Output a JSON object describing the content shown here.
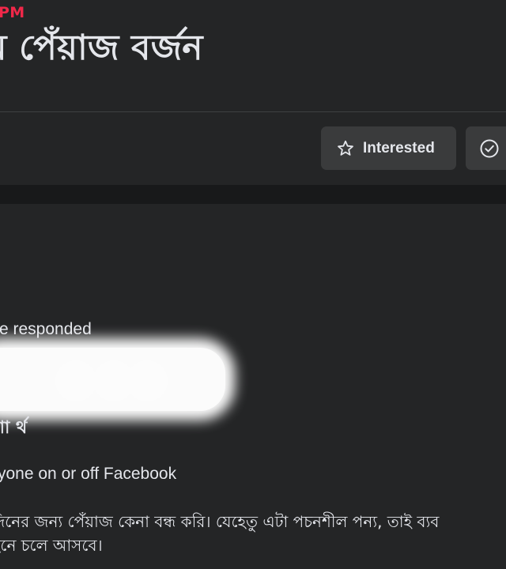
{
  "event": {
    "time_fragment": "PM",
    "title": "ম পেঁয়াজ বর্জন"
  },
  "actions": {
    "interested_label": "Interested",
    "interested_icon": "star-outline-icon",
    "going_icon": "check-circle-icon"
  },
  "details": {
    "responded_text": "e responded",
    "host_text": "শা র্থ",
    "privacy_text": "yone on or off Facebook",
    "description_lines": [
      "দিনের জন্য পেঁয়াজ কেনা বন্ধ করি। যেহেতু এটা পচনশীল পন্য, তাই ব্যব",
      "ইনে চলে আসবে।"
    ]
  },
  "colors": {
    "background": "#242526",
    "button_bg": "#3a3b3c",
    "accent_time": "#f02849",
    "text": "#e4e6eb"
  }
}
